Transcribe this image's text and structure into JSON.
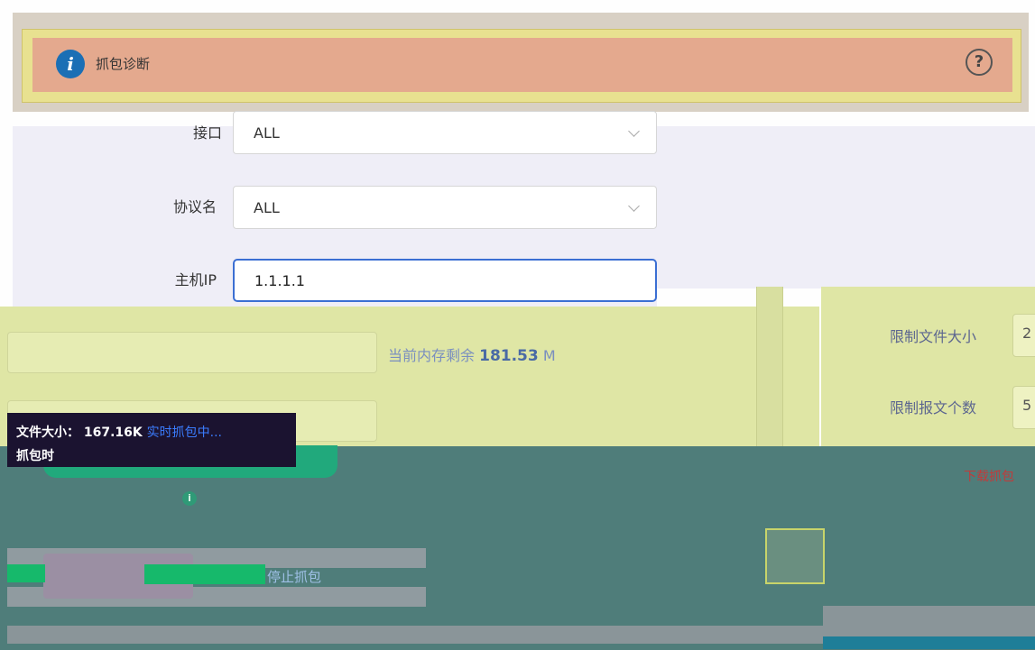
{
  "banner": {
    "title": "抓包诊断",
    "info_icon": "info-icon",
    "help_icon": "help-question-icon"
  },
  "form": {
    "interface": {
      "label": "接口",
      "value": "ALL"
    },
    "protocol": {
      "label": "协议名",
      "value": "ALL"
    },
    "host_ip": {
      "label": "主机IP",
      "value": "1.1.1.1"
    }
  },
  "memory": {
    "prefix": "当前内存剩余",
    "value": "181.53",
    "unit": "M"
  },
  "limits": {
    "file_size": {
      "label": "限制文件大小",
      "value": "2"
    },
    "packet_count": {
      "label": "限制报文个数",
      "value": "5"
    }
  },
  "tooltip": {
    "file_size_label": "文件大小：",
    "file_size_value": "167.16K",
    "status": "实时抓包中...",
    "capture_time_label": "抓包时"
  },
  "actions": {
    "stop": "停止抓包",
    "download": "下载抓包"
  },
  "colors": {
    "accent_blue": "#3b6fd3",
    "teal": "#4f7d7a",
    "green": "#21a97c"
  }
}
